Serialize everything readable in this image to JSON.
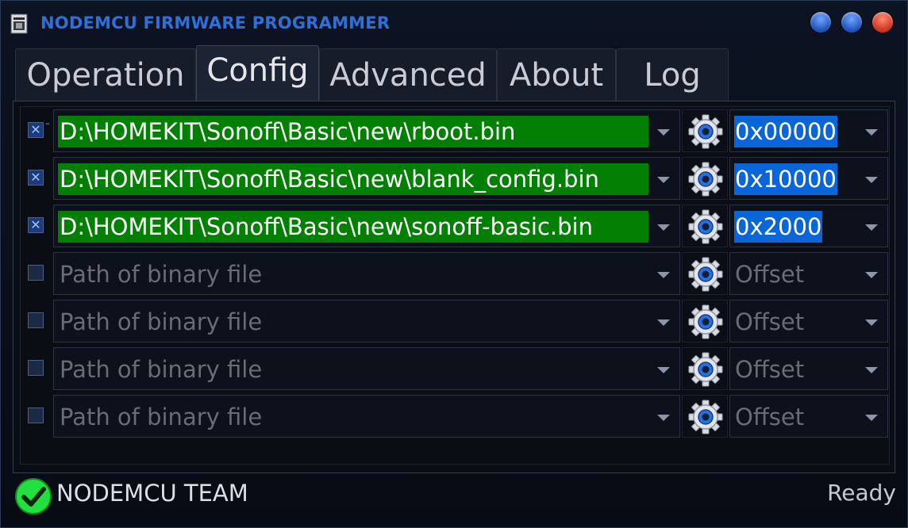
{
  "window": {
    "title": "NODEMCU FIRMWARE PROGRAMMER",
    "controls": [
      "minimize",
      "maximize",
      "close"
    ]
  },
  "tabs": [
    {
      "label": "Operation",
      "active": false
    },
    {
      "label": "Config",
      "active": true
    },
    {
      "label": "Advanced",
      "active": false
    },
    {
      "label": "About",
      "active": false
    },
    {
      "label": "Log",
      "active": false
    }
  ],
  "config": {
    "rows": [
      {
        "checked": true,
        "path": "D:\\HOMEKIT\\Sonoff\\Basic\\new\\rboot.bin",
        "offset": "0x00000"
      },
      {
        "checked": true,
        "path": "D:\\HOMEKIT\\Sonoff\\Basic\\new\\blank_config.bin",
        "offset": "0x10000"
      },
      {
        "checked": true,
        "path": "D:\\HOMEKIT\\Sonoff\\Basic\\new\\sonoff-basic.bin",
        "offset": "0x2000"
      },
      {
        "checked": false,
        "path": "",
        "offset": ""
      },
      {
        "checked": false,
        "path": "",
        "offset": ""
      },
      {
        "checked": false,
        "path": "",
        "offset": ""
      },
      {
        "checked": false,
        "path": "",
        "offset": ""
      }
    ],
    "path_placeholder": "Path of binary file",
    "offset_placeholder": "Offset"
  },
  "status": {
    "left_text": "NODEMCU TEAM",
    "right_text": "Ready",
    "icon": "check-icon"
  },
  "colors": {
    "title_blue": "#2f6fd8",
    "path_fill_green": "#038003",
    "offset_fill_blue": "#0a66d8",
    "status_green": "#22e040"
  }
}
